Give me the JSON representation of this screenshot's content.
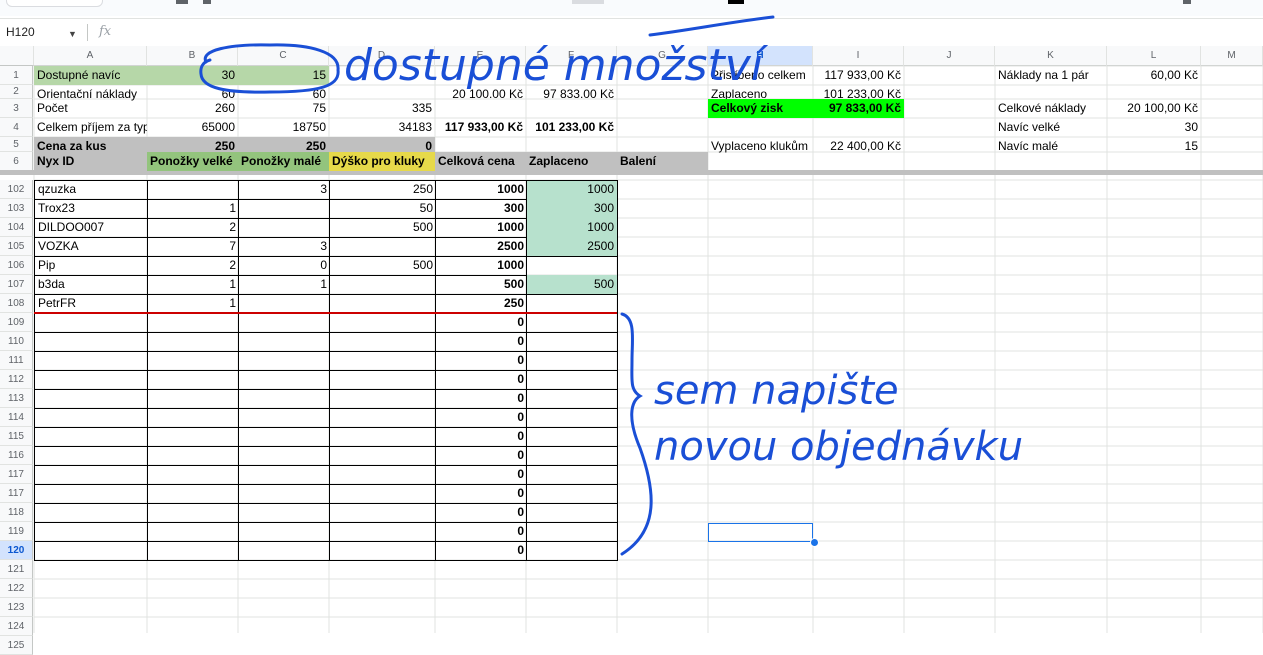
{
  "namebox": "H120",
  "fx": "fx",
  "columns": [
    "A",
    "B",
    "C",
    "D",
    "E",
    "F",
    "G",
    "H",
    "I",
    "J",
    "K",
    "L",
    "M"
  ],
  "row_numbers_top": [
    "1",
    "2",
    "3",
    "4",
    "5",
    "6"
  ],
  "row_numbers_bottom": [
    "102",
    "103",
    "104",
    "105",
    "106",
    "107",
    "108",
    "109",
    "110",
    "111",
    "112",
    "113",
    "114",
    "115",
    "116",
    "117",
    "117",
    "118",
    "119",
    "120",
    "121",
    "122",
    "123",
    "124",
    "125"
  ],
  "summary": {
    "a1": "Dostupné navíc",
    "b1": "30",
    "c1": "15",
    "a2": "Orientační náklady",
    "b2": "60",
    "c2": "60",
    "e2": "20 100.00 Kč",
    "f2": "97 833.00 Kč",
    "a3": "Počet",
    "b3": "260",
    "c3": "75",
    "d3": "335",
    "a4": "Celkem příjem za typ",
    "b4": "65000",
    "c4": "18750",
    "d4": "34183",
    "e4": "117 933,00 Kč",
    "f4": "101 233,00 Kč",
    "a5": "Cena za kus",
    "b5": "250",
    "c5": "250",
    "d5": "0"
  },
  "headers": {
    "a6": "Nyx ID",
    "b6": "Ponožky velké",
    "c6": "Ponožky malé",
    "d6": "Dýško pro kluky",
    "e6": "Celková cena",
    "f6": "Zaplaceno",
    "g6": "Balení"
  },
  "right_panel": {
    "h1": "Přislíbeno celkem",
    "i1": "117 933,00 Kč",
    "h2": "Zaplaceno",
    "i2": "101 233,00 Kč",
    "h3": "Celkový zisk",
    "i3": "97 833,00 Kč",
    "h5": "Vyplaceno klukům",
    "i5": "22 400,00 Kč",
    "k1": "Náklady na 1 pár",
    "l1": "60,00 Kč",
    "k3": "Celkové náklady",
    "l3": "20 100,00 Kč",
    "k4": "Navíc velké",
    "l4": "30",
    "k5": "Navíc malé",
    "l5": "15"
  },
  "orders": [
    {
      "id": "qzuzka",
      "b": "",
      "c": "3",
      "d": "250",
      "e": "1000",
      "f": "1000"
    },
    {
      "id": "Trox23",
      "b": "1",
      "c": "",
      "d": "50",
      "e": "300",
      "f": "300"
    },
    {
      "id": "DILDOO007",
      "b": "2",
      "c": "",
      "d": "500",
      "e": "1000",
      "f": "1000"
    },
    {
      "id": "VOZKA",
      "b": "7",
      "c": "3",
      "d": "",
      "e": "2500",
      "f": "2500"
    },
    {
      "id": "Pip",
      "b": "2",
      "c": "0",
      "d": "500",
      "e": "1000",
      "f": ""
    },
    {
      "id": "b3da",
      "b": "1",
      "c": "1",
      "d": "",
      "e": "500",
      "f": "500"
    },
    {
      "id": "PetrFR",
      "b": "1",
      "c": "",
      "d": "",
      "e": "250",
      "f": ""
    }
  ],
  "empty_totals": [
    "0",
    "0",
    "0",
    "0",
    "0",
    "0",
    "0",
    "0",
    "0",
    "0",
    "0",
    "0",
    "0"
  ],
  "annotations": {
    "top": "dostupné množství",
    "right_line1": "sem napište",
    "right_line2": "novou objednávku"
  },
  "colors": {
    "green_light": "#b6d7a8",
    "green_paid": "#b7e1cd",
    "green_bright": "#00ff00",
    "gray_header": "#c0c0c0",
    "yellow_header": "#e6d94a",
    "ink_blue": "#1a4fd6",
    "red_line": "#cc0000"
  }
}
